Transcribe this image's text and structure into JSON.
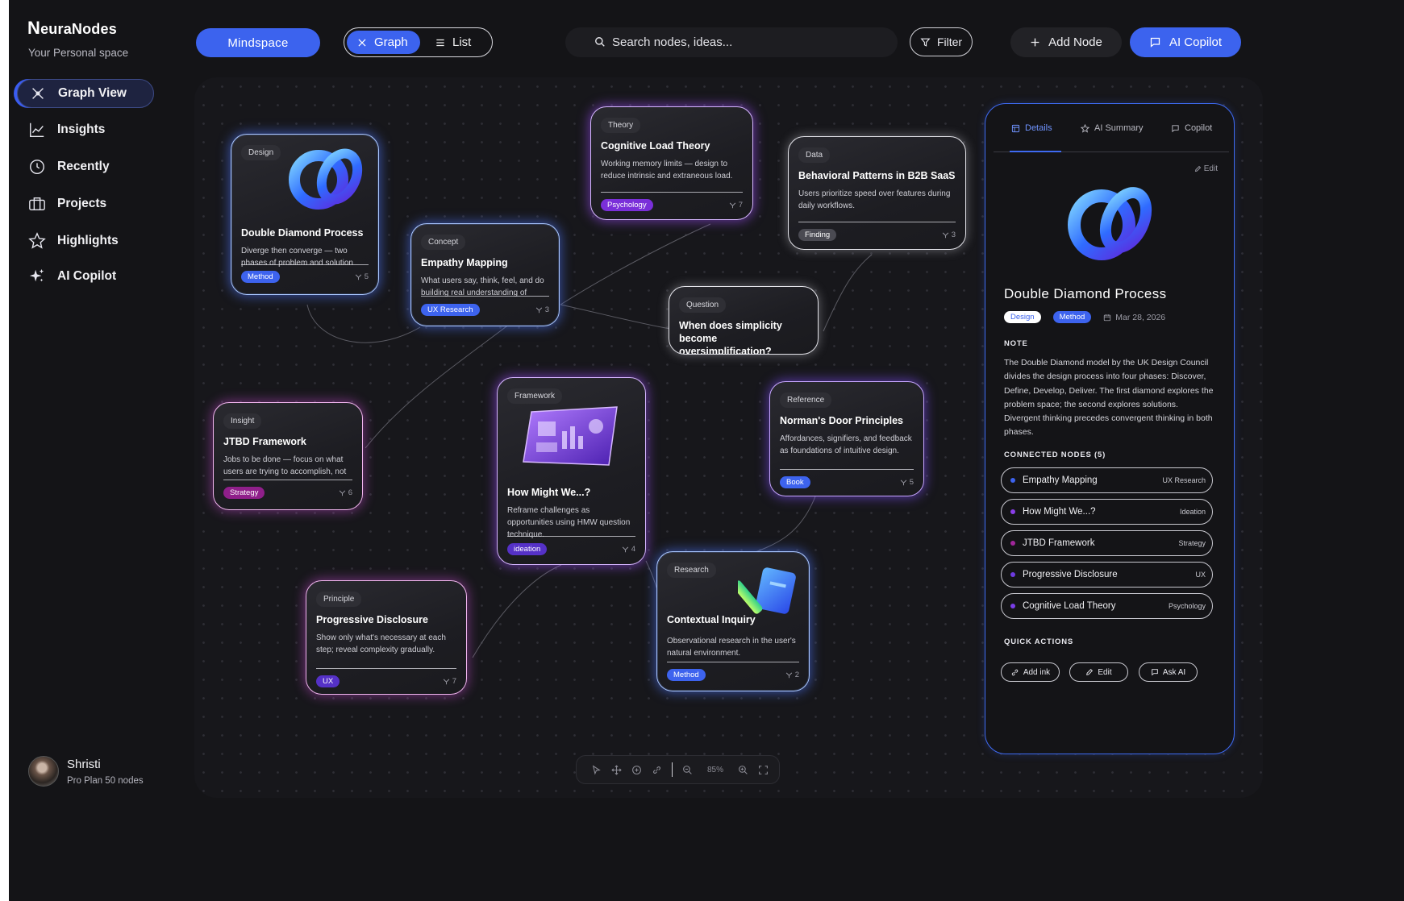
{
  "brand": {
    "name": "euraNodes",
    "initial": "N",
    "subtitle": "Your Personal space"
  },
  "sidebar": {
    "items": [
      {
        "label": "Graph View",
        "icon": "graph-icon",
        "active": true
      },
      {
        "label": "Insights",
        "icon": "chart-icon"
      },
      {
        "label": "Recently",
        "icon": "clock-icon"
      },
      {
        "label": "Projects",
        "icon": "briefcase-icon"
      },
      {
        "label": "Highlights",
        "icon": "star-icon"
      },
      {
        "label": "AI Copilot",
        "icon": "sparkle-icon"
      }
    ]
  },
  "user": {
    "name": "Shristi",
    "plan": "Pro Plan 50 nodes"
  },
  "topbar": {
    "mindspace": "Mindspace",
    "view_graph": "Graph",
    "view_list": "List",
    "search_placeholder": "Search nodes, ideas...",
    "filter": "Filter",
    "add_node": "Add Node",
    "ai_copilot": "AI Copilot"
  },
  "nodes": [
    {
      "type": "Design",
      "title": "Double Diamond Process",
      "desc": "Diverge then converge — two phases of problem and solution",
      "tag": "Method",
      "count": "5"
    },
    {
      "type": "Concept",
      "title": "Empathy Mapping",
      "desc": "What users say, think, feel, and do building real understanding of",
      "tag": "UX Research",
      "count": "3"
    },
    {
      "type": "Theory",
      "title": "Cognitive Load Theory",
      "desc": "Working memory limits — design to reduce intrinsic and extraneous load.",
      "tag": "Psychology",
      "count": "7"
    },
    {
      "type": "Data",
      "title": "Behavioral Patterns in B2B SaaS",
      "desc": "Users prioritize speed over features during daily workflows.",
      "tag": "Finding",
      "count": "3"
    },
    {
      "type": "Question",
      "title": "When does simplicity become oversimplification?"
    },
    {
      "type": "Insight",
      "title": "JTBD Framework",
      "desc": "Jobs to be done — focus on what users are trying to accomplish, not",
      "tag": "Strategy",
      "count": "6"
    },
    {
      "type": "Framework",
      "title": "How Might We...?",
      "desc": "Reframe challenges as opportunities using HMW question technique.",
      "tag": "ideation",
      "count": "4"
    },
    {
      "type": "Reference",
      "title": "Norman's Door Principles",
      "desc": "Affordances, signifiers, and feedback as foundations of intuitive design.",
      "tag": "Book",
      "count": "5"
    },
    {
      "type": "Principle",
      "title": "Progressive Disclosure",
      "desc": "Show only what's necessary at each step; reveal complexity gradually.",
      "tag": "UX",
      "count": "7"
    },
    {
      "type": "Research",
      "title": "Contextual Inquiry",
      "desc": "Observational research in the user's natural environment.",
      "tag": "Method",
      "count": "2"
    }
  ],
  "toolbar": {
    "zoom": "85%"
  },
  "panel": {
    "tabs": [
      "Details",
      "AI Summary",
      "Copilot"
    ],
    "edit": "Edit",
    "title": "Double Diamond Process",
    "tags": [
      "Design",
      "Method"
    ],
    "date": "Mar 28, 2026",
    "note_label": "NOTE",
    "note": "The Double Diamond model by the UK Design Council divides the design process into four phases: Discover, Define, Develop, Deliver. The first diamond explores the problem space; the second explores solutions. Divergent thinking precedes convergent thinking in both phases.",
    "connected_label": "CONNECTED NODES (5)",
    "connected": [
      {
        "name": "Empathy Mapping",
        "category": "UX Research",
        "color": "#3d63ee"
      },
      {
        "name": "How Might We...?",
        "category": "Ideation",
        "color": "#8a3ee8"
      },
      {
        "name": "JTBD Framework",
        "category": "Strategy",
        "color": "#a0269a"
      },
      {
        "name": "Progressive Disclosure",
        "category": "UX",
        "color": "#6d3ae0"
      },
      {
        "name": "Cognitive Load Theory",
        "category": "Psychology",
        "color": "#7a3ee8"
      }
    ],
    "quick_label": "QUICK ACTIONS",
    "quick_actions": [
      "Add ink",
      "Edit",
      "Ask AI"
    ]
  },
  "colors": {
    "accent": "#3c63ee",
    "background": "#141417",
    "panel_border": "#3e6af2"
  }
}
